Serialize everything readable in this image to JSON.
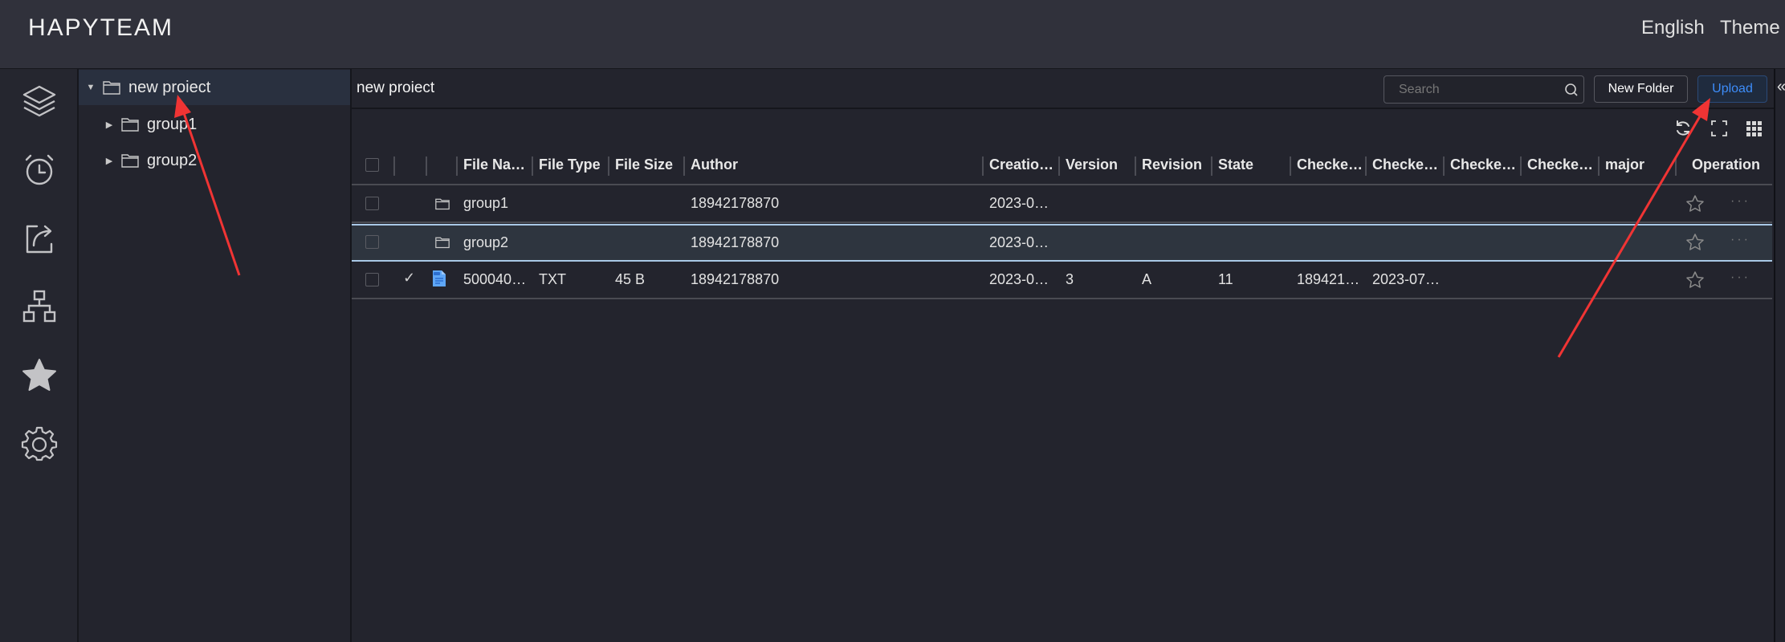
{
  "app": {
    "title": "HAPYTEAM"
  },
  "topbar": {
    "language_label": "English",
    "theme_label": "Theme"
  },
  "sidebar": {
    "items": [
      {
        "icon": "layers-icon",
        "name": "projects"
      },
      {
        "icon": "alarm-clock-icon",
        "name": "recent"
      },
      {
        "icon": "share-icon",
        "name": "shared"
      },
      {
        "icon": "org-chart-icon",
        "name": "structure"
      },
      {
        "icon": "star-icon",
        "name": "favorites"
      },
      {
        "icon": "gear-icon",
        "name": "settings"
      }
    ]
  },
  "tree": {
    "root": {
      "label": "new proiect",
      "expanded": true,
      "selected": true
    },
    "children": [
      {
        "label": "group1",
        "expanded": false
      },
      {
        "label": "group2",
        "expanded": false
      }
    ]
  },
  "content": {
    "breadcrumb": "new proiect",
    "search": {
      "placeholder": "Search",
      "value": ""
    },
    "new_folder_label": "New Folder",
    "upload_label": "Upload",
    "collapse_glyph": "«",
    "toolbar": [
      "refresh-icon",
      "fullscreen-icon",
      "column-settings-icon"
    ]
  },
  "table": {
    "columns": [
      "",
      "",
      "",
      "File Na…",
      "File Type",
      "File Size",
      "Author",
      "Creatio…",
      "Version",
      "Revision",
      "State",
      "Checke…",
      "Checke…",
      "Checke…",
      "Checke…",
      "major",
      "Operation"
    ],
    "rows": [
      {
        "checked_out": false,
        "type_icon": "folder",
        "name": "group1",
        "file_type": "",
        "file_size": "",
        "author": "18942178870",
        "creation": "2023-0…",
        "version": "",
        "revision": "",
        "state": "",
        "checked_out_by": "",
        "checked_out_date": "",
        "c3": "",
        "c4": "",
        "major": "",
        "highlighted": false
      },
      {
        "checked_out": false,
        "type_icon": "folder",
        "name": "group2",
        "file_type": "",
        "file_size": "",
        "author": "18942178870",
        "creation": "2023-0…",
        "version": "",
        "revision": "",
        "state": "",
        "checked_out_by": "",
        "checked_out_date": "",
        "c3": "",
        "c4": "",
        "major": "",
        "highlighted": true
      },
      {
        "checked_out": true,
        "type_icon": "txt-file",
        "name": "500040…",
        "file_type": "TXT",
        "file_size": "45 B",
        "author": "18942178870",
        "creation": "2023-0…",
        "version": "3",
        "revision": "A",
        "state": "11",
        "checked_out_by": "189421…",
        "checked_out_date": "2023-07…",
        "c3": "",
        "c4": "",
        "major": "",
        "highlighted": false
      }
    ],
    "check_glyph": "✓",
    "more_glyph": "···"
  },
  "colors": {
    "accent": "#3d8dfa",
    "annotation": "#f03434",
    "row_highlight_border": "#a9c8e6"
  }
}
